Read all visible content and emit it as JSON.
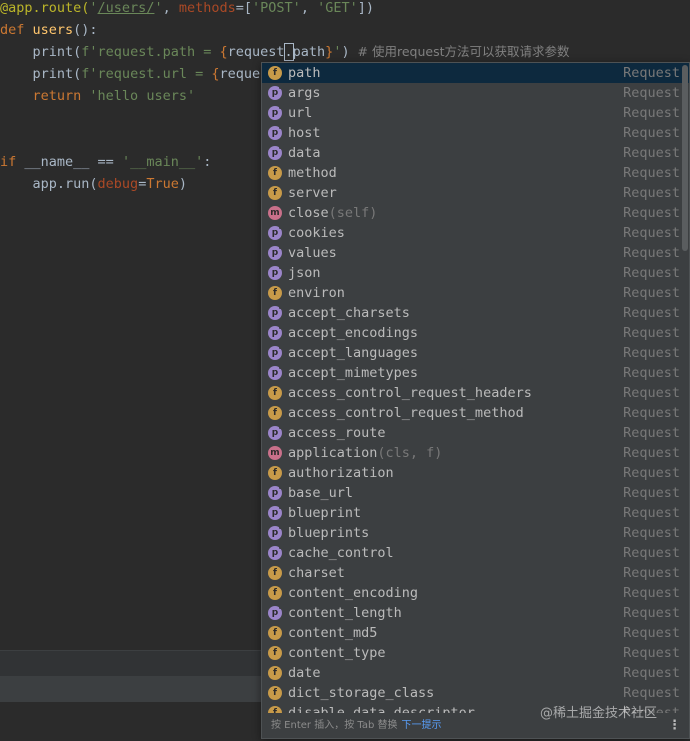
{
  "code": {
    "line1": {
      "decorator": "@app.route(",
      "q1": "'",
      "route_path": "/users/",
      "q2": "'",
      "comma": ", ",
      "param": "methods",
      "eq": "=[",
      "str1": "'POST'",
      "comma2": ", ",
      "str2": "'GET'",
      "end": "])"
    },
    "line2": {
      "kw": "def ",
      "fn": "users",
      "rest": "():"
    },
    "line3": {
      "indent": "    ",
      "call": "print(",
      "fstr_open": "f'request.path = ",
      "brace_open": "{",
      "expr_a": "request",
      "caret": ".",
      "expr_b": "path",
      "brace_close": "}",
      "fstr_close": "'",
      "paren": ")",
      "comment": "  # 使用request方法可以获取请求参数"
    },
    "line4": {
      "indent": "    ",
      "call": "print(",
      "fstr_open": "f'request.url = ",
      "brace_open": "{",
      "expr_a": "reques"
    },
    "line5": {
      "indent": "    ",
      "kw": "return ",
      "str": "'hello users'"
    },
    "line8": {
      "kw": "if ",
      "plain": "__name__ == ",
      "str": "'__main__'",
      "end": ":"
    },
    "line9": {
      "indent": "    ",
      "call": "app.run(",
      "param": "debug",
      "eq": "=",
      "kw": "True",
      "end": ")"
    }
  },
  "completion": {
    "type_label": "Request",
    "items": [
      {
        "icon": "f",
        "name": "path",
        "sig": "",
        "selected": true
      },
      {
        "icon": "p",
        "name": "args",
        "sig": ""
      },
      {
        "icon": "p",
        "name": "url",
        "sig": ""
      },
      {
        "icon": "p",
        "name": "host",
        "sig": ""
      },
      {
        "icon": "p",
        "name": "data",
        "sig": ""
      },
      {
        "icon": "f",
        "name": "method",
        "sig": ""
      },
      {
        "icon": "f",
        "name": "server",
        "sig": ""
      },
      {
        "icon": "m",
        "name": "close",
        "sig": "(self)"
      },
      {
        "icon": "p",
        "name": "cookies",
        "sig": ""
      },
      {
        "icon": "p",
        "name": "values",
        "sig": ""
      },
      {
        "icon": "p",
        "name": "json",
        "sig": ""
      },
      {
        "icon": "f",
        "name": "environ",
        "sig": ""
      },
      {
        "icon": "p",
        "name": "accept_charsets",
        "sig": ""
      },
      {
        "icon": "p",
        "name": "accept_encodings",
        "sig": ""
      },
      {
        "icon": "p",
        "name": "accept_languages",
        "sig": ""
      },
      {
        "icon": "p",
        "name": "accept_mimetypes",
        "sig": ""
      },
      {
        "icon": "f",
        "name": "access_control_request_headers",
        "sig": ""
      },
      {
        "icon": "f",
        "name": "access_control_request_method",
        "sig": ""
      },
      {
        "icon": "p",
        "name": "access_route",
        "sig": ""
      },
      {
        "icon": "m",
        "name": "application",
        "sig": "(cls, f)"
      },
      {
        "icon": "f",
        "name": "authorization",
        "sig": ""
      },
      {
        "icon": "p",
        "name": "base_url",
        "sig": ""
      },
      {
        "icon": "p",
        "name": "blueprint",
        "sig": ""
      },
      {
        "icon": "p",
        "name": "blueprints",
        "sig": ""
      },
      {
        "icon": "p",
        "name": "cache_control",
        "sig": ""
      },
      {
        "icon": "f",
        "name": "charset",
        "sig": ""
      },
      {
        "icon": "f",
        "name": "content_encoding",
        "sig": ""
      },
      {
        "icon": "p",
        "name": "content_length",
        "sig": ""
      },
      {
        "icon": "f",
        "name": "content_md5",
        "sig": ""
      },
      {
        "icon": "f",
        "name": "content_type",
        "sig": ""
      },
      {
        "icon": "f",
        "name": "date",
        "sig": ""
      },
      {
        "icon": "f",
        "name": "dict_storage_class",
        "sig": ""
      },
      {
        "icon": "f",
        "name": "disable_data_descriptor",
        "sig": ""
      }
    ],
    "footer": {
      "hint": "按 Enter 插入，按 Tab 替换",
      "next_tip": "下一提示",
      "more": "⋮"
    }
  },
  "watermark": "@稀土掘金技术社区",
  "colors": {
    "background": "#2b2b2b",
    "popup": "#3c3f41",
    "selection": "#0d293e",
    "icon_field": "#c79a49",
    "icon_method": "#c9708a",
    "icon_property": "#9b85c9"
  }
}
